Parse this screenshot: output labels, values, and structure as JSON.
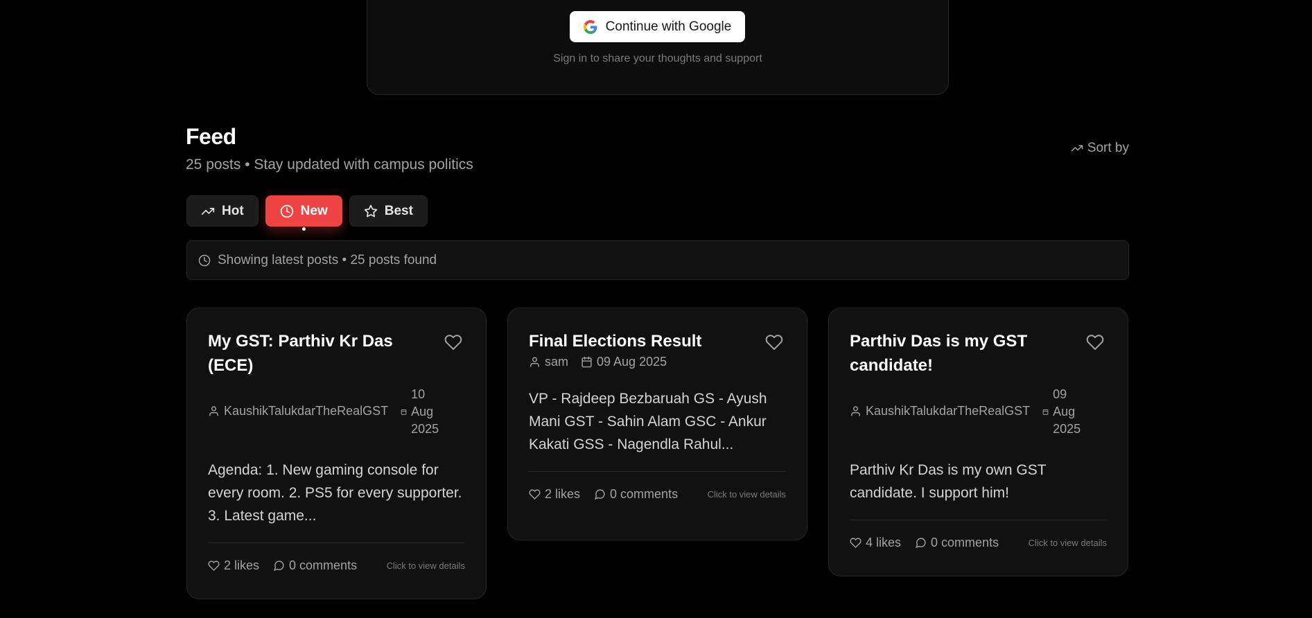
{
  "signin": {
    "google_button": "Continue with Google",
    "hint": "Sign in to share your thoughts and support"
  },
  "feed": {
    "title": "Feed",
    "subtitle": "25 posts • Stay updated with campus politics",
    "sort_label": "Sort by",
    "tabs": [
      {
        "label": "Hot",
        "icon": "trending-up-icon"
      },
      {
        "label": "New",
        "icon": "clock-icon",
        "active": true
      },
      {
        "label": "Best",
        "icon": "star-icon"
      }
    ],
    "status": "Showing latest posts • 25 posts found",
    "accent": "#ef4444"
  },
  "posts": [
    {
      "title": "My GST: Parthiv Kr Das (ECE)",
      "author": "KaushikTalukdarTheRealGST",
      "date_parts": [
        "10",
        "Aug",
        "2025"
      ],
      "excerpt": "Agenda: 1. New gaming console for every room. 2. PS5 for every supporter. 3. Latest game...",
      "likes": "2 likes",
      "comments": "0 comments",
      "details": "Click to view details"
    },
    {
      "title": "Final Elections Result",
      "author": "sam",
      "date": "09 Aug 2025",
      "excerpt": "VP - Rajdeep Bezbaruah GS - Ayush Mani GST - Sahin Alam GSC - Ankur Kakati GSS - Nagendla Rahul...",
      "likes": "2 likes",
      "comments": "0 comments",
      "details": "Click to view details"
    },
    {
      "title": "Parthiv Das is my GST candidate!",
      "author": "KaushikTalukdarTheRealGST",
      "date_parts": [
        "09",
        "Aug",
        "2025"
      ],
      "excerpt": "Parthiv Kr Das is my own GST candidate. I support him!",
      "likes": "4 likes",
      "comments": "0 comments",
      "details": "Click to view details"
    }
  ]
}
